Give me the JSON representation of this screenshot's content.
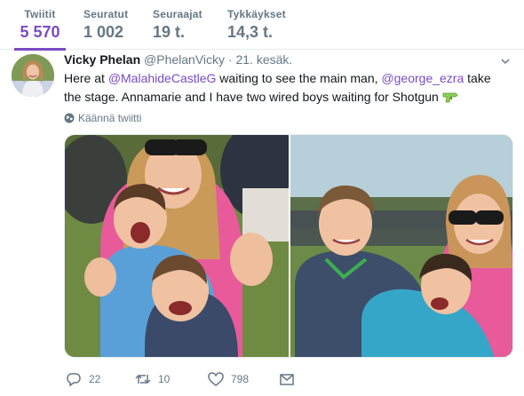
{
  "profile_nav": {
    "tabs": [
      {
        "label": "Twiitit",
        "value": "5 570",
        "active": true
      },
      {
        "label": "Seuratut",
        "value": "1 002"
      },
      {
        "label": "Seuraajat",
        "value": "19 t."
      },
      {
        "label": "Tykkäykset",
        "value": "14,3 t."
      }
    ]
  },
  "tweet": {
    "fullname": "Vicky Phelan",
    "screenname": "@PhelanVicky",
    "separator": "·",
    "time": "21. kesäk.",
    "text": {
      "part1": "Here at ",
      "mention1": "@MalahideCastleG",
      "part2": " waiting to see the main man, ",
      "mention2": "@george_ezra",
      "part3": " take the stage. Annamarie and I have two wired boys waiting for Shotgun "
    },
    "translate_label": "Käännä twiitti",
    "actions": {
      "replies": "22",
      "retweets": "10",
      "likes": "798"
    }
  },
  "colors": {
    "accent": "#794bc4",
    "secondary_text": "#657786",
    "primary_text": "#14171a",
    "divider": "#e6ecf0"
  },
  "icons": [
    "chevron-down-icon",
    "globe-icon",
    "reply-icon",
    "retweet-icon",
    "heart-icon",
    "envelope-icon",
    "water-pistol-emoji"
  ]
}
